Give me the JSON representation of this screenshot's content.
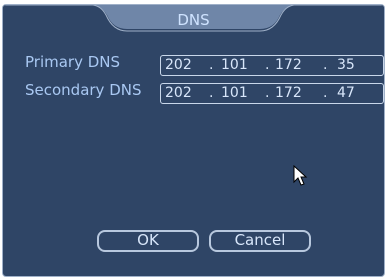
{
  "dialog": {
    "title": "DNS",
    "primary": {
      "label": "Primary DNS",
      "octets": [
        "202",
        "101",
        "172",
        "35"
      ]
    },
    "secondary": {
      "label": "Secondary DNS",
      "octets": [
        "202",
        "101",
        "172",
        "47"
      ]
    },
    "buttons": {
      "ok": "OK",
      "cancel": "Cancel"
    }
  },
  "colors": {
    "panel_bg": "#2f4566",
    "title_tab": "#6f86a8",
    "label_text": "#a9c8f2",
    "field_border": "#c9d7ea"
  },
  "icons": [
    "mouse-pointer-icon"
  ]
}
